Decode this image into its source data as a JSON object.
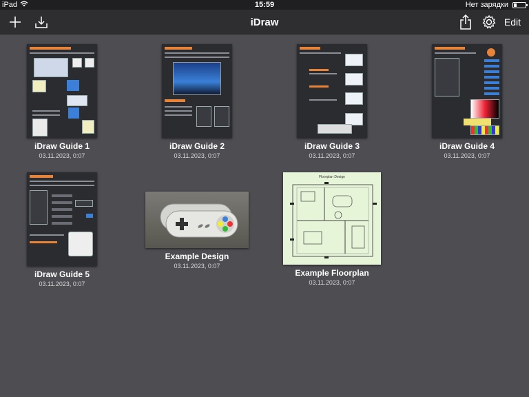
{
  "status": {
    "device": "iPad",
    "time": "15:59",
    "charging": "Нет зарядки"
  },
  "nav": {
    "title": "iDraw",
    "edit_label": "Edit",
    "icons": [
      "plus-icon",
      "download-icon",
      "share-icon",
      "gear-icon"
    ]
  },
  "documents": [
    {
      "name": "iDraw Guide 1",
      "date": "03.11.2023, 0:07"
    },
    {
      "name": "iDraw Guide 2",
      "date": "03.11.2023, 0:07"
    },
    {
      "name": "iDraw Guide 3",
      "date": "03.11.2023, 0:07"
    },
    {
      "name": "iDraw Guide 4",
      "date": "03.11.2023, 0:07"
    },
    {
      "name": "iDraw Guide 5",
      "date": "03.11.2023, 0:07"
    },
    {
      "name": "Example Design",
      "date": "03.11.2023, 0:07"
    },
    {
      "name": "Example Floorplan",
      "date": "03.11.2023, 0:07"
    }
  ],
  "floorplan_title": "Floorplan Design",
  "colors": {
    "background": "#4d4d52",
    "navbar": "#2e2e31",
    "guide_page": "#2b2c30",
    "floorplan_paper": "#e6f5d8"
  }
}
